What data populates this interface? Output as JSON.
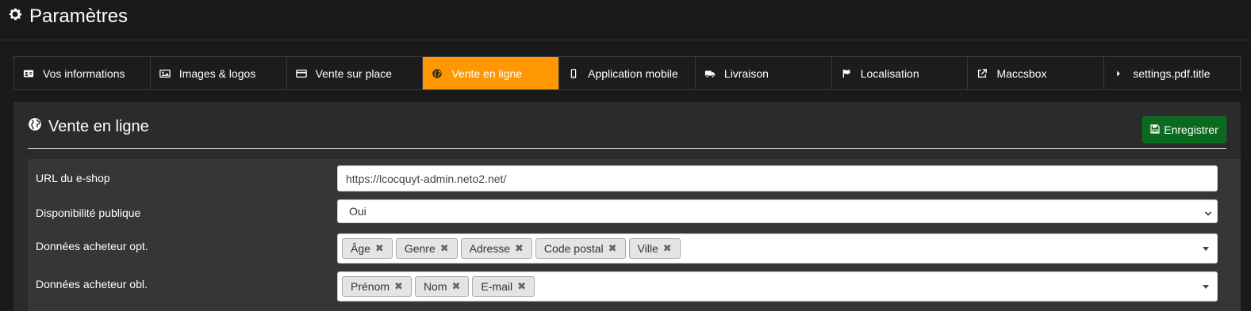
{
  "page": {
    "title": "Paramètres",
    "icon": "gear-icon"
  },
  "tabs": [
    {
      "label": "Vos informations",
      "icon": "id-card-icon",
      "active": false
    },
    {
      "label": "Images & logos",
      "icon": "image-icon",
      "active": false
    },
    {
      "label": "Vente sur place",
      "icon": "credit-card-icon",
      "active": false
    },
    {
      "label": "Vente en ligne",
      "icon": "globe-icon",
      "active": true
    },
    {
      "label": "Application mobile",
      "icon": "mobile-icon",
      "active": false
    },
    {
      "label": "Livraison",
      "icon": "truck-icon",
      "active": false
    },
    {
      "label": "Localisation",
      "icon": "flag-icon",
      "active": false
    },
    {
      "label": "Maccsbox",
      "icon": "external-link-icon",
      "active": false
    },
    {
      "label": "settings.pdf.title",
      "icon": "caret-right-icon",
      "active": false
    }
  ],
  "panel": {
    "title": "Vente en ligne",
    "icon": "globe-icon",
    "save_label": "Enregistrer"
  },
  "form": {
    "eshop_url": {
      "label": "URL du e-shop",
      "value": "https://lcocquyt-admin.neto2.net/"
    },
    "availability": {
      "label": "Disponibilité publique",
      "value": "Oui"
    },
    "optional_data": {
      "label": "Données acheteur opt.",
      "tags": [
        "Âge",
        "Genre",
        "Adresse",
        "Code postal",
        "Ville"
      ]
    },
    "required_data": {
      "label": "Données acheteur obl.",
      "tags": [
        "Prénom",
        "Nom",
        "E-mail"
      ]
    }
  },
  "colors": {
    "background": "#1a1a1a",
    "active_tab": "#ff9800",
    "save_button": "#0b6a1f",
    "panel": "#2b2b2b",
    "form_area": "#363636"
  }
}
